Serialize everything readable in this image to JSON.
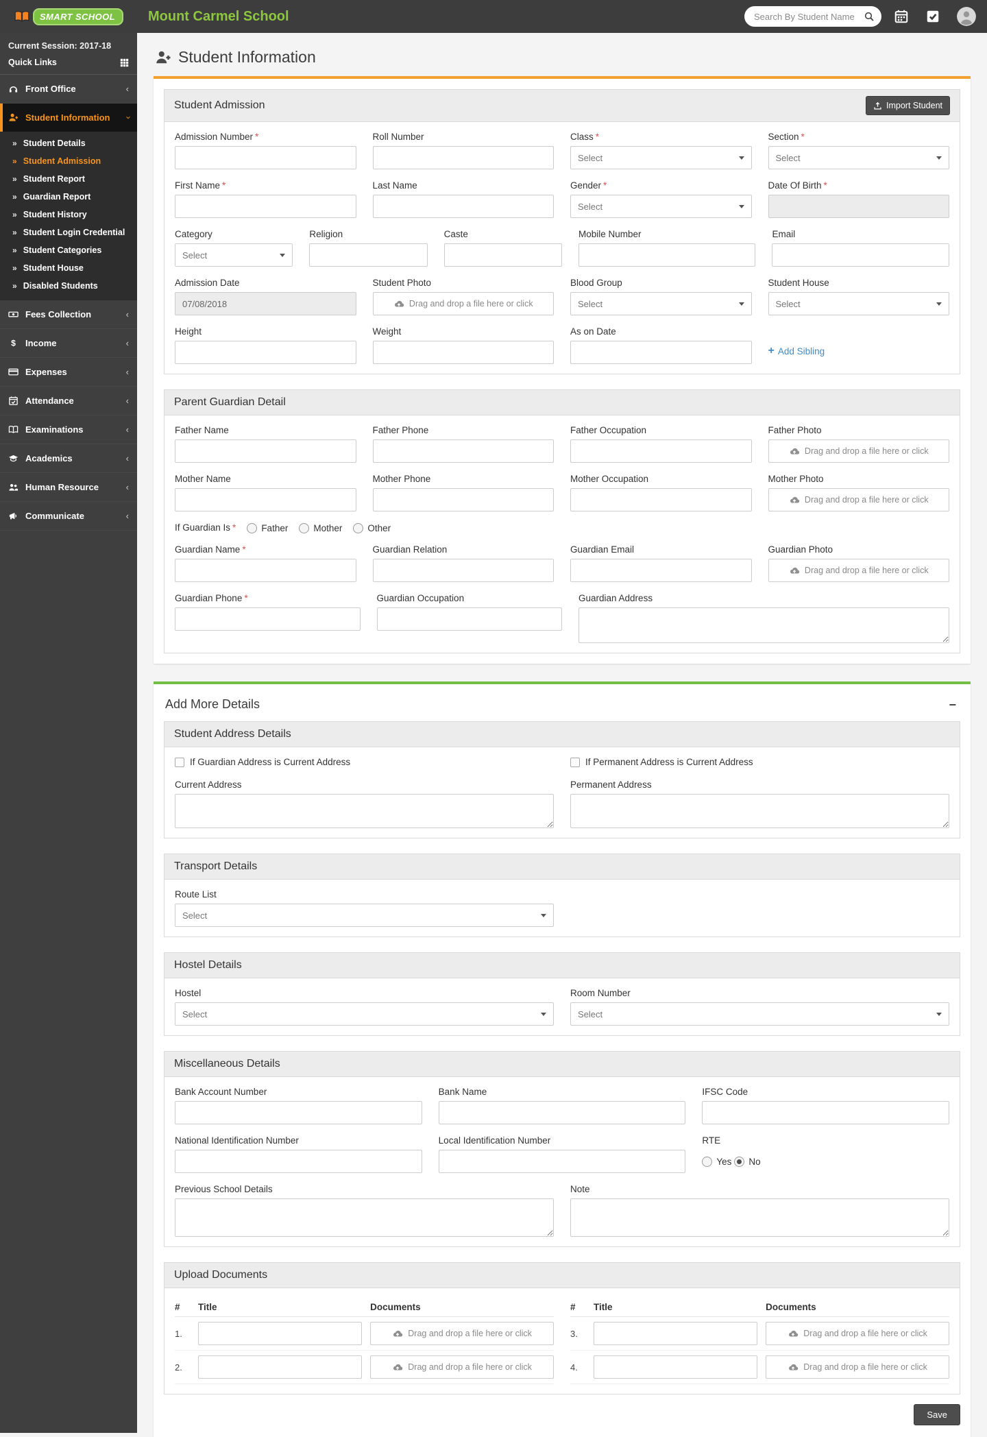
{
  "icons": {
    "chevron": "‹",
    "submenu_arrow": "»",
    "plus": "+",
    "minus": "−"
  },
  "header": {
    "logo_text": "SMART SCHOOL",
    "school_name": "Mount Carmel School",
    "search_placeholder": "Search By Student Name"
  },
  "sidebar": {
    "session": "Current Session: 2017-18",
    "quick_links": "Quick Links",
    "front_office": "Front Office",
    "student_information": "Student Information",
    "submenu": [
      "Student Details",
      "Student Admission",
      "Student Report",
      "Guardian Report",
      "Student History",
      "Student Login Credential",
      "Student Categories",
      "Student House",
      "Disabled Students"
    ],
    "menu": [
      "Fees Collection",
      "Income",
      "Expenses",
      "Attendance",
      "Examinations",
      "Academics",
      "Human Resource",
      "Communicate"
    ]
  },
  "page": {
    "title": "Student Information"
  },
  "common": {
    "select": "Select",
    "dropzone": "Drag and drop a file here or click",
    "required": "*"
  },
  "admission": {
    "title": "Student Admission",
    "import_button": "Import Student",
    "labels": {
      "admission_number": "Admission Number",
      "roll_number": "Roll Number",
      "class": "Class",
      "section": "Section",
      "first_name": "First Name",
      "last_name": "Last Name",
      "gender": "Gender",
      "dob": "Date Of Birth",
      "category": "Category",
      "religion": "Religion",
      "caste": "Caste",
      "mobile": "Mobile Number",
      "email": "Email",
      "admission_date": "Admission Date",
      "student_photo": "Student Photo",
      "blood_group": "Blood Group",
      "student_house": "Student House",
      "height": "Height",
      "weight": "Weight",
      "as_on_date": "As on Date"
    },
    "admission_date_value": "07/08/2018",
    "add_sibling": "Add Sibling"
  },
  "guardian": {
    "title": "Parent Guardian Detail",
    "labels": {
      "father_name": "Father Name",
      "father_phone": "Father Phone",
      "father_occupation": "Father Occupation",
      "father_photo": "Father Photo",
      "mother_name": "Mother Name",
      "mother_phone": "Mother Phone",
      "mother_occupation": "Mother Occupation",
      "mother_photo": "Mother Photo",
      "if_guardian_is": "If Guardian Is",
      "guardian_name": "Guardian Name",
      "guardian_relation": "Guardian Relation",
      "guardian_email": "Guardian Email",
      "guardian_photo": "Guardian Photo",
      "guardian_phone": "Guardian Phone",
      "guardian_occupation": "Guardian Occupation",
      "guardian_address": "Guardian Address"
    },
    "radio_options": [
      "Father",
      "Mother",
      "Other"
    ]
  },
  "more": {
    "title": "Add More Details",
    "address": {
      "title": "Student Address Details",
      "check_guardian": "If Guardian Address is Current Address",
      "check_permanent": "If Permanent Address is Current Address",
      "current": "Current Address",
      "permanent": "Permanent Address"
    },
    "transport": {
      "title": "Transport Details",
      "route": "Route List"
    },
    "hostel": {
      "title": "Hostel Details",
      "hostel": "Hostel",
      "room": "Room Number"
    },
    "misc": {
      "title": "Miscellaneous Details",
      "bank_account": "Bank Account Number",
      "bank_name": "Bank Name",
      "ifsc": "IFSC Code",
      "national_id": "National Identification Number",
      "local_id": "Local Identification Number",
      "rte": "RTE",
      "rte_yes": "Yes",
      "rte_no": "No",
      "previous_school": "Previous School Details",
      "note": "Note"
    },
    "upload": {
      "title": "Upload Documents",
      "col_num": "#",
      "col_title": "Title",
      "col_docs": "Documents",
      "rows": [
        "1.",
        "2.",
        "3.",
        "4."
      ]
    },
    "save": "Save"
  },
  "colors": {
    "accent_orange": "#f7941d",
    "accent_green": "#72bf44",
    "link_blue": "#428bca",
    "topbar": "#3d3d3d",
    "sidebar": "#3f3f3f"
  }
}
